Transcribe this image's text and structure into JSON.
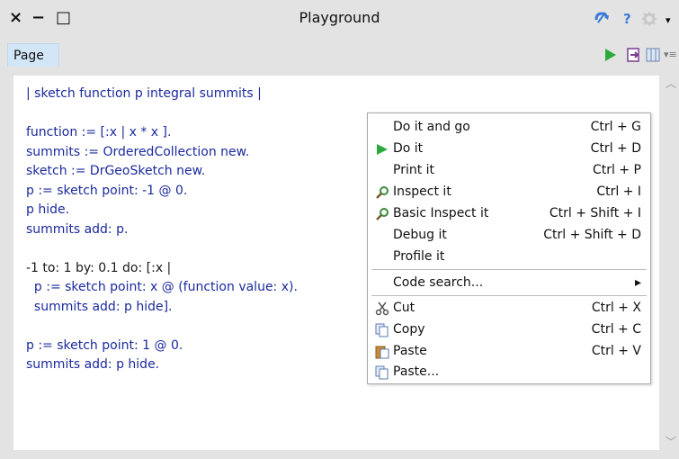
{
  "window": {
    "title": "Playground",
    "close_symbol": "×",
    "minimize_symbol": "−",
    "maximize_symbol": "□",
    "help_symbol": "?",
    "menu_symbol": "▾"
  },
  "tabs": [
    {
      "label": "Page",
      "active": true
    }
  ],
  "toolbar": {
    "run_icon": "play-icon",
    "bind_icon": "bind-icon",
    "columns_icon": "columns-icon",
    "more_icon": "more-menu-icon"
  },
  "code_lines": [
    "| sketch function p integral summits |",
    "",
    "function := [:x | x * x ].",
    "summits := OrderedCollection new.",
    "sketch := DrGeoSketch new.",
    "p := sketch point: -1 @ 0.",
    "p hide.",
    "summits add: p.",
    "",
    "-1 to: 1 by: 0.1 do: [:x |",
    "  p := sketch point: x @ (function value: x).",
    "  summits add: p hide].",
    "",
    "p := sketch point: 1 @ 0.",
    "summits add: p hide."
  ],
  "context_menu": {
    "items": [
      {
        "label": "Do it and go",
        "shortcut": "Ctrl + G",
        "icon": ""
      },
      {
        "label": "Do it",
        "shortcut": "Ctrl + D",
        "icon": "play-icon"
      },
      {
        "label": "Print it",
        "shortcut": "Ctrl + P",
        "icon": ""
      },
      {
        "label": "Inspect it",
        "shortcut": "Ctrl + I",
        "icon": "inspect-icon"
      },
      {
        "label": "Basic Inspect it",
        "shortcut": "Ctrl + Shift + I",
        "icon": "inspect-icon"
      },
      {
        "label": "Debug it",
        "shortcut": "Ctrl + Shift + D",
        "icon": ""
      },
      {
        "label": "Profile it",
        "shortcut": "",
        "icon": ""
      },
      {
        "label": "Code search...",
        "shortcut": "▸",
        "icon": ""
      },
      {
        "label": "Cut",
        "shortcut": "Ctrl + X",
        "icon": "scissors-icon"
      },
      {
        "label": "Copy",
        "shortcut": "Ctrl + C",
        "icon": "copy-icon"
      },
      {
        "label": "Paste",
        "shortcut": "Ctrl + V",
        "icon": "paste-icon"
      },
      {
        "label": "Paste...",
        "shortcut": "",
        "icon": "paste-icon"
      }
    ]
  },
  "colors": {
    "keyword": "#1b2a9e",
    "number": "#b02020",
    "tab": "#d3e6f7",
    "play": "#2eaa3c"
  }
}
